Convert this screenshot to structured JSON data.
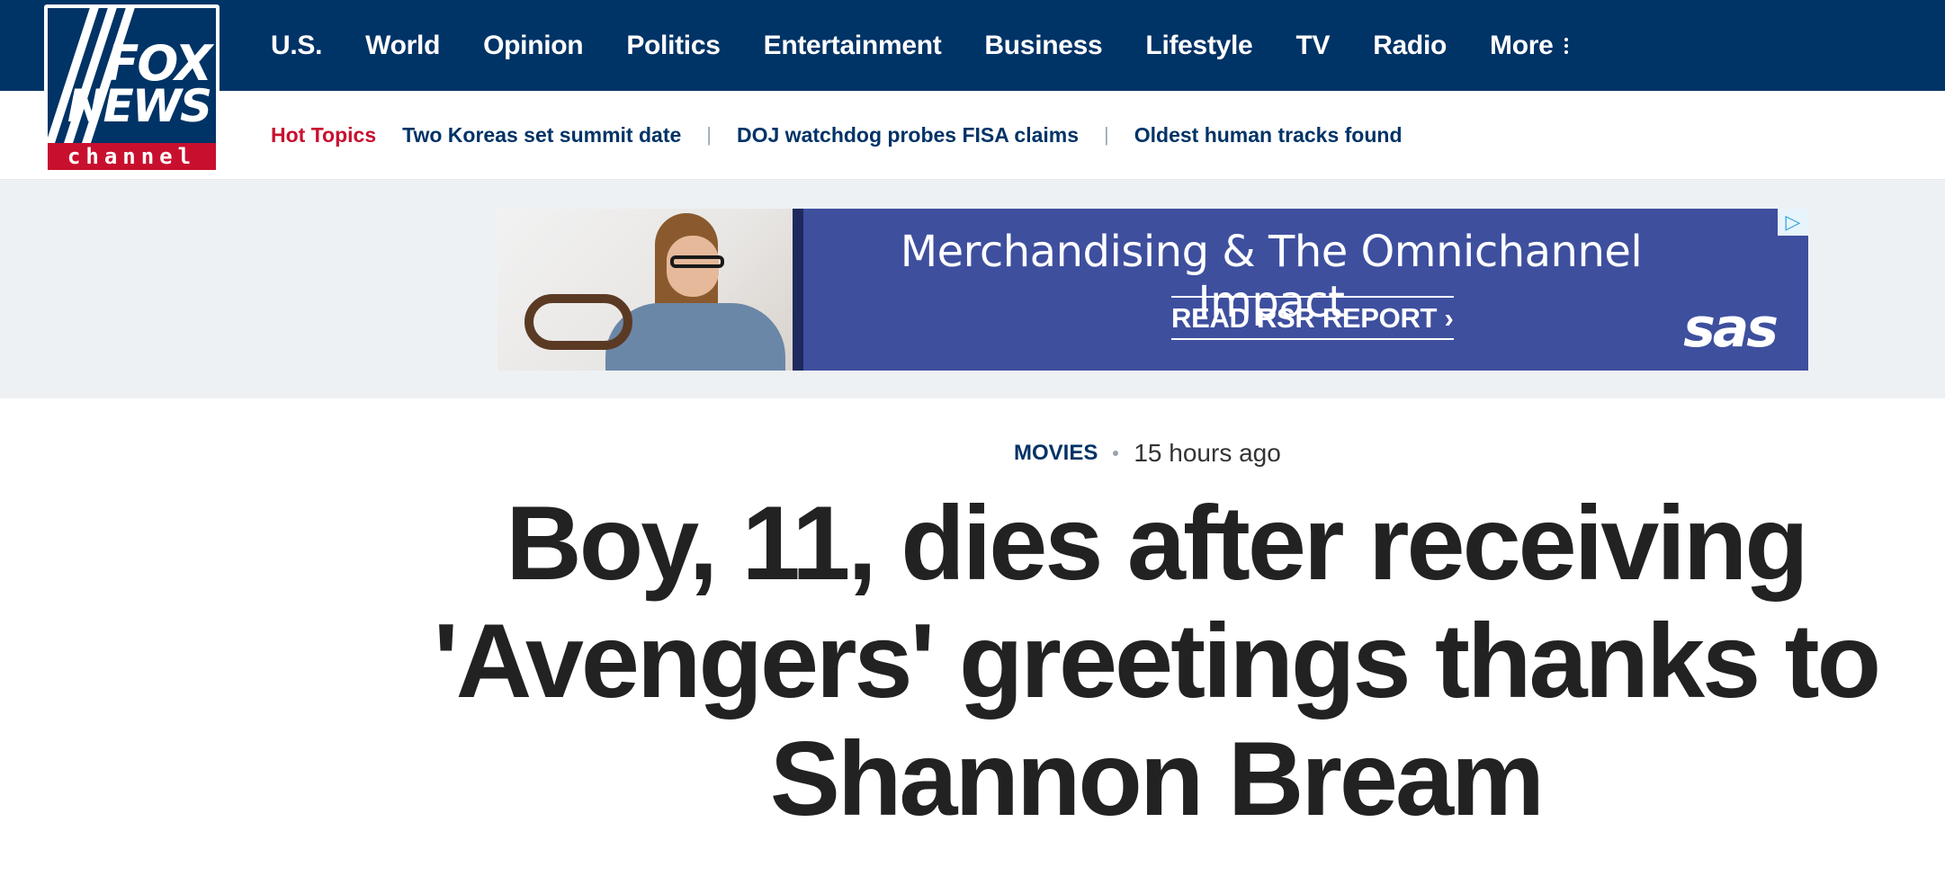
{
  "brand": {
    "logo_top": "FOX",
    "logo_middle": "NEWS",
    "logo_bottom": "channel"
  },
  "main_nav": {
    "items": [
      {
        "label": "U.S."
      },
      {
        "label": "World"
      },
      {
        "label": "Opinion"
      },
      {
        "label": "Politics"
      },
      {
        "label": "Entertainment"
      },
      {
        "label": "Business"
      },
      {
        "label": "Lifestyle"
      },
      {
        "label": "TV"
      },
      {
        "label": "Radio"
      },
      {
        "label": "More"
      }
    ]
  },
  "hot_topics": {
    "label": "Hot Topics",
    "items": [
      {
        "label": "Two Koreas set summit date"
      },
      {
        "label": "DOJ watchdog probes FISA claims"
      },
      {
        "label": "Oldest human tracks found"
      }
    ]
  },
  "ad": {
    "title": "Merchandising & The Omnichannel Impact",
    "cta": "READ RSR REPORT ›",
    "brand": "sas",
    "background_color": "#3e4f9e"
  },
  "article": {
    "category": "Movies",
    "time": "15 hours ago",
    "headline": "Boy, 11, dies after receiving 'Avengers' greetings thanks to Shannon Bream"
  },
  "colors": {
    "nav_bg": "#003366",
    "hot_label": "#c8102e",
    "link": "#003366",
    "headline": "#222222"
  }
}
